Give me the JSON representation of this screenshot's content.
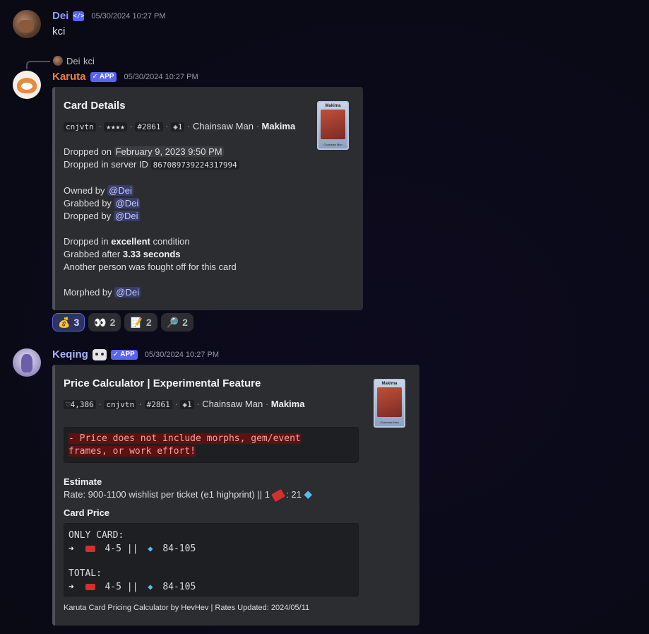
{
  "messages": [
    {
      "author": "Dei",
      "timestamp": "05/30/2024 10:27 PM",
      "content": "kci"
    },
    {
      "author": "Karuta",
      "app_tag": "APP",
      "timestamp": "05/30/2024 10:27 PM",
      "reply": {
        "author": "Dei",
        "content": "kci"
      },
      "embed": {
        "title": "Card Details",
        "summary": {
          "code": "cnjvtn",
          "stars": "★★★★",
          "number": "#2861",
          "edition": "◈1",
          "series": "Chainsaw Man",
          "character": "Makima"
        },
        "dropped_on_label": "Dropped on",
        "dropped_on": "February 9, 2023 9:50 PM",
        "server_label": "Dropped in server ID",
        "server_id": "867089739224317994",
        "owned_label": "Owned by",
        "owned": "@Dei",
        "grabbed_label": "Grabbed by",
        "grabbed": "@Dei",
        "dropped_label": "Dropped by",
        "dropped": "@Dei",
        "condition_pre": "Dropped in",
        "condition": "excellent",
        "condition_post": "condition",
        "grab_pre": "Grabbed after",
        "grab_time": "3.33 seconds",
        "fight_text": "Another person was fought off for this card",
        "morphed_label": "Morphed by",
        "morphed": "@Dei",
        "thumb_name": "Makima",
        "thumb_series": "Chainsaw Man"
      },
      "reactions": [
        {
          "emoji": "money-bag",
          "glyph": "💰",
          "count": "3",
          "active": true
        },
        {
          "emoji": "eyes",
          "glyph": "👀",
          "count": "2",
          "active": false
        },
        {
          "emoji": "memo",
          "glyph": "📝",
          "count": "2",
          "active": false
        },
        {
          "emoji": "magnifier",
          "glyph": "🔎",
          "count": "2",
          "active": false
        }
      ]
    },
    {
      "author": "Keqing",
      "app_tag": "APP",
      "timestamp": "05/30/2024 10:27 PM",
      "embed": {
        "title": "Price Calculator | Experimental Feature",
        "summary": {
          "wishlist": "♡4,386",
          "code": "cnjvtn",
          "number": "#2861",
          "edition": "◈1",
          "series": "Chainsaw Man",
          "character": "Makima"
        },
        "warning_line1": "- Price does not include morphs, gem/event",
        "warning_line2": "frames, or work effort!",
        "estimate_label": "Estimate",
        "rate_text": "Rate: 900-1100 wishlist per ticket (e1 highprint) || 1",
        "rate_ticket_sep": ": 21",
        "card_price_label": "Card Price",
        "only_card_label": "ONLY CARD:",
        "only_card_tickets": "4-5 ||",
        "only_card_gems": "84-105",
        "total_label": "TOTAL:",
        "total_tickets": "4-5 ||",
        "total_gems": "84-105",
        "arrow": "➔",
        "footer": "Karuta Card Pricing Calculator by HevHev | Rates Updated: 2024/05/11",
        "thumb_name": "Makima",
        "thumb_series": "Chainsaw Man"
      }
    }
  ],
  "colors": {
    "dei_name": "#8c9eff",
    "karuta_name": "#f47b3b",
    "keqing_name": "#a9b4ff",
    "accent": "#5865f2"
  }
}
